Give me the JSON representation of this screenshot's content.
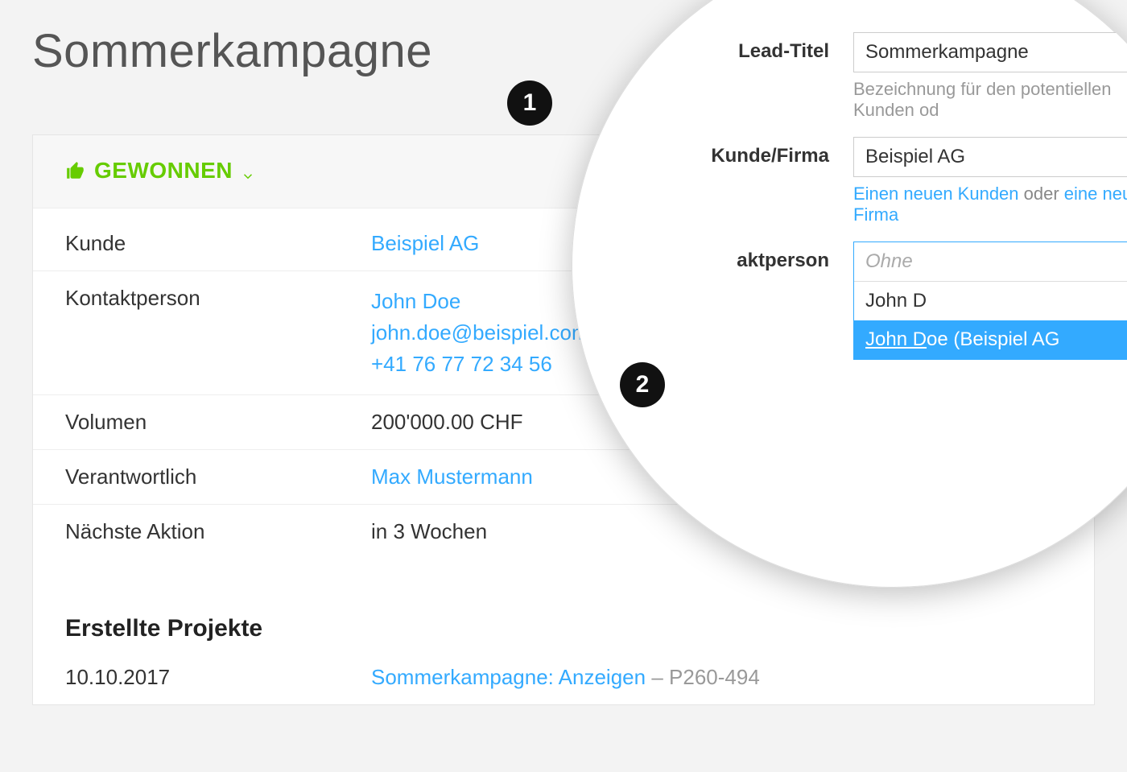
{
  "page": {
    "title": "Sommerkampagne"
  },
  "status": {
    "label": "GEWONNEN"
  },
  "details": {
    "kunde_label": "Kunde",
    "kunde_value": "Beispiel AG",
    "kontakt_label": "Kontaktperson",
    "kontakt_name": "John Doe",
    "kontakt_email": "john.doe@beispiel.com",
    "kontakt_phone": "+41 76 77 72 34 56",
    "volumen_label": "Volumen",
    "volumen_value": "200'000.00 CHF",
    "verantwortlich_label": "Verantwortlich",
    "verantwortlich_value": "Max Mustermann",
    "naechste_label": "Nächste Aktion",
    "naechste_value": "in 3 Wochen"
  },
  "projects": {
    "section_title": "Erstellte Projekte",
    "items": [
      {
        "date": "10.10.2017",
        "name": "Sommerkampagne: Anzeigen",
        "separator": " – ",
        "code": "P260-494"
      }
    ]
  },
  "magnifier": {
    "lead_titel_label": "Lead-Titel",
    "lead_titel_value": "Sommerkampagne",
    "lead_titel_hint": "Bezeichnung für den potentiellen Kunden od",
    "kunde_firma_label": "Kunde/Firma",
    "kunde_firma_value": "Beispiel AG",
    "new_customer_link": "Einen neuen Kunden",
    "or_text": " oder ",
    "new_company_link": "eine neue Firma",
    "kontakt_label": "aktperson",
    "kontakt_placeholder": "Ohne",
    "kontakt_typed": "John D",
    "kontakt_option_prefix": "John D",
    "kontakt_option_rest": "oe (Beispiel AG"
  },
  "callouts": {
    "one": "1",
    "two": "2"
  }
}
